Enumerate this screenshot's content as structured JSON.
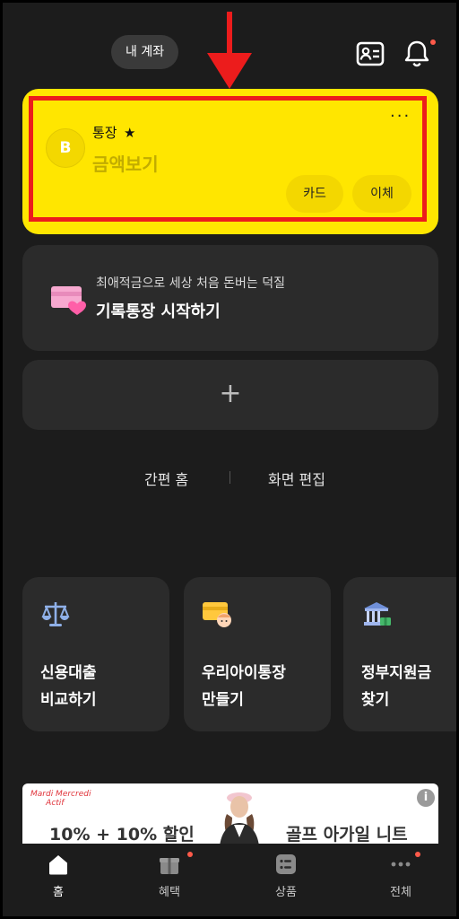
{
  "header": {
    "account_pill_label": "내 계좌"
  },
  "account_card": {
    "name": "통장",
    "star": "★",
    "balance_label": "금액보기",
    "more": "···",
    "bank_logo": "B",
    "buttons": [
      "카드",
      "이체"
    ],
    "colors": {
      "card_bg": "#ffe600",
      "highlight_border": "#ec1c1c"
    }
  },
  "promo": {
    "subtitle": "최애적금으로 세상 처음 돈버는 덕질",
    "title": "기록통장 시작하기"
  },
  "add_card": {
    "label": "+"
  },
  "links": {
    "simple_home": "간편 홈",
    "edit_screen": "화면 편집"
  },
  "tiles": [
    {
      "label": "신용대출\n비교하기",
      "icon": "scale-icon"
    },
    {
      "label": "우리아이통장\n만들기",
      "icon": "child-card-icon"
    },
    {
      "label": "정부지원금\n찾기",
      "icon": "government-building-icon"
    }
  ],
  "ad": {
    "brand": "Mardi Mercredi\nActif",
    "left_text": "10% + 10% 할인",
    "right_text": "골프 아가일 니트",
    "info": "i"
  },
  "nav": {
    "items": [
      {
        "label": "홈",
        "icon": "home-icon",
        "active": true
      },
      {
        "label": "혜택",
        "icon": "gift-icon",
        "active": false
      },
      {
        "label": "상품",
        "icon": "products-icon",
        "active": false
      },
      {
        "label": "전체",
        "icon": "more-icon",
        "active": false
      }
    ]
  }
}
